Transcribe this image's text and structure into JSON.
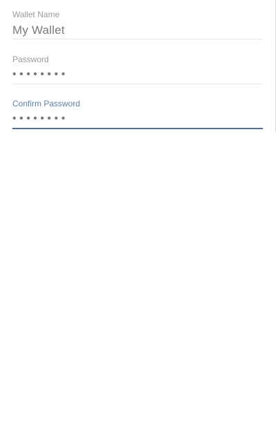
{
  "form": {
    "wallet_name": {
      "label": "Wallet Name",
      "value": "My Wallet"
    },
    "password": {
      "label": "Password",
      "value": "••••••••"
    },
    "confirm_password": {
      "label": "Confirm Password",
      "value": "••••••••"
    }
  },
  "colors": {
    "label_inactive": "#9a9a9a",
    "label_active": "#5b7ea6",
    "underline_inactive": "#e6e6e6",
    "underline_active": "#4d6f99",
    "value_text": "#7a7a7a"
  }
}
